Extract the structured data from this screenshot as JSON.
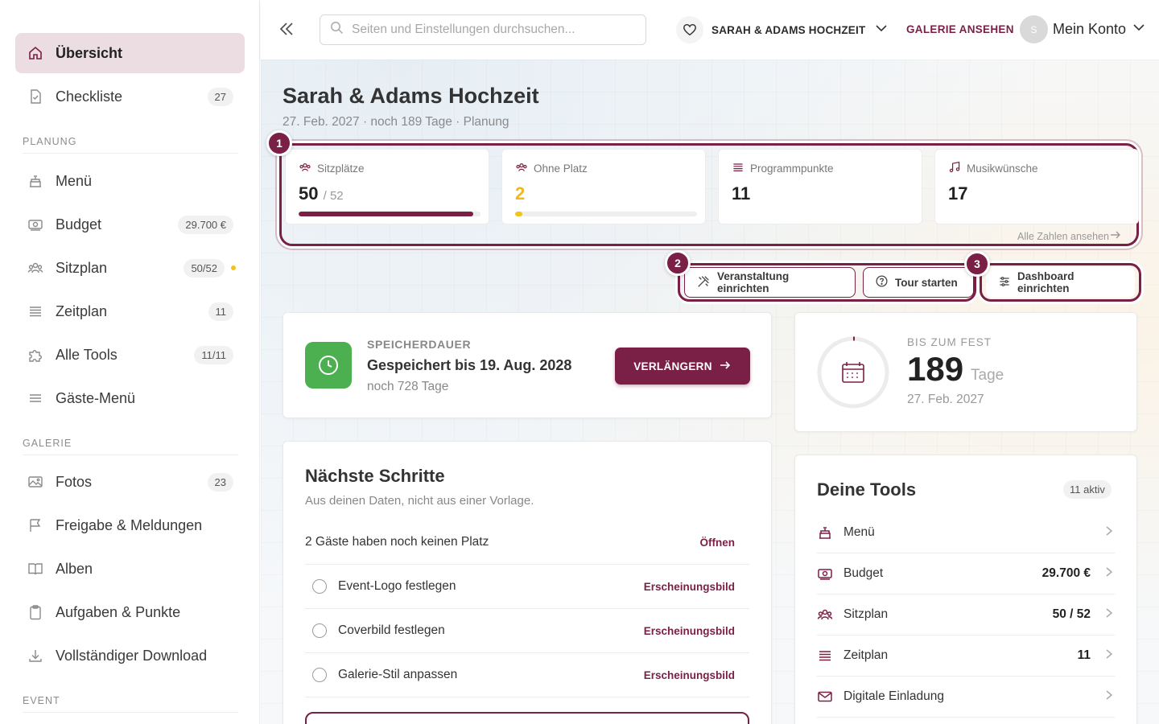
{
  "sidebar": {
    "items": [
      {
        "label": "Übersicht",
        "badge": "",
        "icon": "home-icon",
        "active": true
      },
      {
        "label": "Checkliste",
        "badge": "27",
        "icon": "checklist-icon"
      }
    ],
    "sections": [
      {
        "heading": "PLANUNG",
        "items": [
          {
            "label": "Menü",
            "badge": "",
            "icon": "cake-icon"
          },
          {
            "label": "Budget",
            "badge": "29.700 €",
            "icon": "money-icon"
          },
          {
            "label": "Sitzplan",
            "badge": "50/52",
            "icon": "people-icon",
            "dot": true
          },
          {
            "label": "Zeitplan",
            "badge": "11",
            "icon": "schedule-icon"
          },
          {
            "label": "Alle Tools",
            "badge": "11/11",
            "icon": "puzzle-icon"
          },
          {
            "label": "Gäste-Menü",
            "badge": "",
            "icon": "menu-lines-icon"
          }
        ]
      },
      {
        "heading": "GALERIE",
        "items": [
          {
            "label": "Fotos",
            "badge": "23",
            "icon": "image-icon"
          },
          {
            "label": "Freigabe & Meldungen",
            "badge": "",
            "icon": "flag-icon"
          },
          {
            "label": "Alben",
            "badge": "",
            "icon": "book-icon"
          },
          {
            "label": "Aufgaben & Punkte",
            "badge": "",
            "icon": "clipboard-icon"
          },
          {
            "label": "Vollständiger Download",
            "badge": "",
            "icon": "download-icon"
          }
        ]
      },
      {
        "heading": "EVENT",
        "items": []
      }
    ]
  },
  "topbar": {
    "search_placeholder": "Seiten und Einstellungen durchsuchen...",
    "event_name": "SARAH & ADAMS HOCHZEIT",
    "gallery_link": "GALERIE ANSEHEN",
    "avatar_initial": "S",
    "account_label": "Mein Konto"
  },
  "page": {
    "title": "Sarah & Adams Hochzeit",
    "subtitle": "27. Feb. 2027 · noch 189 Tage · Planung"
  },
  "stats": [
    {
      "label": "Sitzplätze",
      "value": "50",
      "of": "/ 52",
      "progress": 0.96,
      "bar_color": "#7a1f45",
      "icon": "people-icon"
    },
    {
      "label": "Ohne Platz",
      "value": "2",
      "of": "",
      "progress": 0.04,
      "bar_color": "#f0c419",
      "icon": "people-icon",
      "highlight": "#f0b81f"
    },
    {
      "label": "Programmpunkte",
      "value": "11",
      "of": "",
      "icon": "schedule-icon"
    },
    {
      "label": "Musikwünsche",
      "value": "17",
      "of": "",
      "icon": "music-icon"
    }
  ],
  "all_numbers_link": "Alle Zahlen ansehen",
  "tour_steps": [
    "1",
    "2",
    "3"
  ],
  "actions": {
    "setup_event": "Veranstaltung einrichten",
    "start_tour": "Tour starten",
    "setup_dashboard": "Dashboard einrichten"
  },
  "storage": {
    "kicker": "SPEICHERDAUER",
    "main": "Gespeichert bis 19. Aug. 2028",
    "sub": "noch 728 Tage",
    "button": "VERLÄNGERN"
  },
  "countdown": {
    "kicker": "BIS ZUM FEST",
    "days": "189",
    "unit": "Tage",
    "date": "27. Feb. 2027"
  },
  "next_steps": {
    "title": "Nächste Schritte",
    "subtitle": "Aus deinen Daten, nicht aus einer Vorlage.",
    "rows": [
      {
        "text": "2 Gäste haben noch keinen Platz",
        "action": "Öffnen",
        "checkbox": false
      },
      {
        "text": "Event-Logo festlegen",
        "action": "Erscheinungsbild",
        "checkbox": true
      },
      {
        "text": "Coverbild festlegen",
        "action": "Erscheinungsbild",
        "checkbox": true
      },
      {
        "text": "Galerie-Stil anpassen",
        "action": "Erscheinungsbild",
        "checkbox": true
      }
    ]
  },
  "tools": {
    "title": "Deine Tools",
    "badge": "11 aktiv",
    "rows": [
      {
        "label": "Menü",
        "value": "",
        "icon": "cake-icon"
      },
      {
        "label": "Budget",
        "value": "29.700 €",
        "icon": "money-icon"
      },
      {
        "label": "Sitzplan",
        "value": "50 / 52",
        "icon": "people-icon"
      },
      {
        "label": "Zeitplan",
        "value": "11",
        "icon": "schedule-icon"
      },
      {
        "label": "Digitale Einladung",
        "value": "",
        "icon": "mail-icon"
      }
    ]
  },
  "colors": {
    "accent": "#7a1f45",
    "success": "#4caf50",
    "warning": "#f0b81f"
  }
}
